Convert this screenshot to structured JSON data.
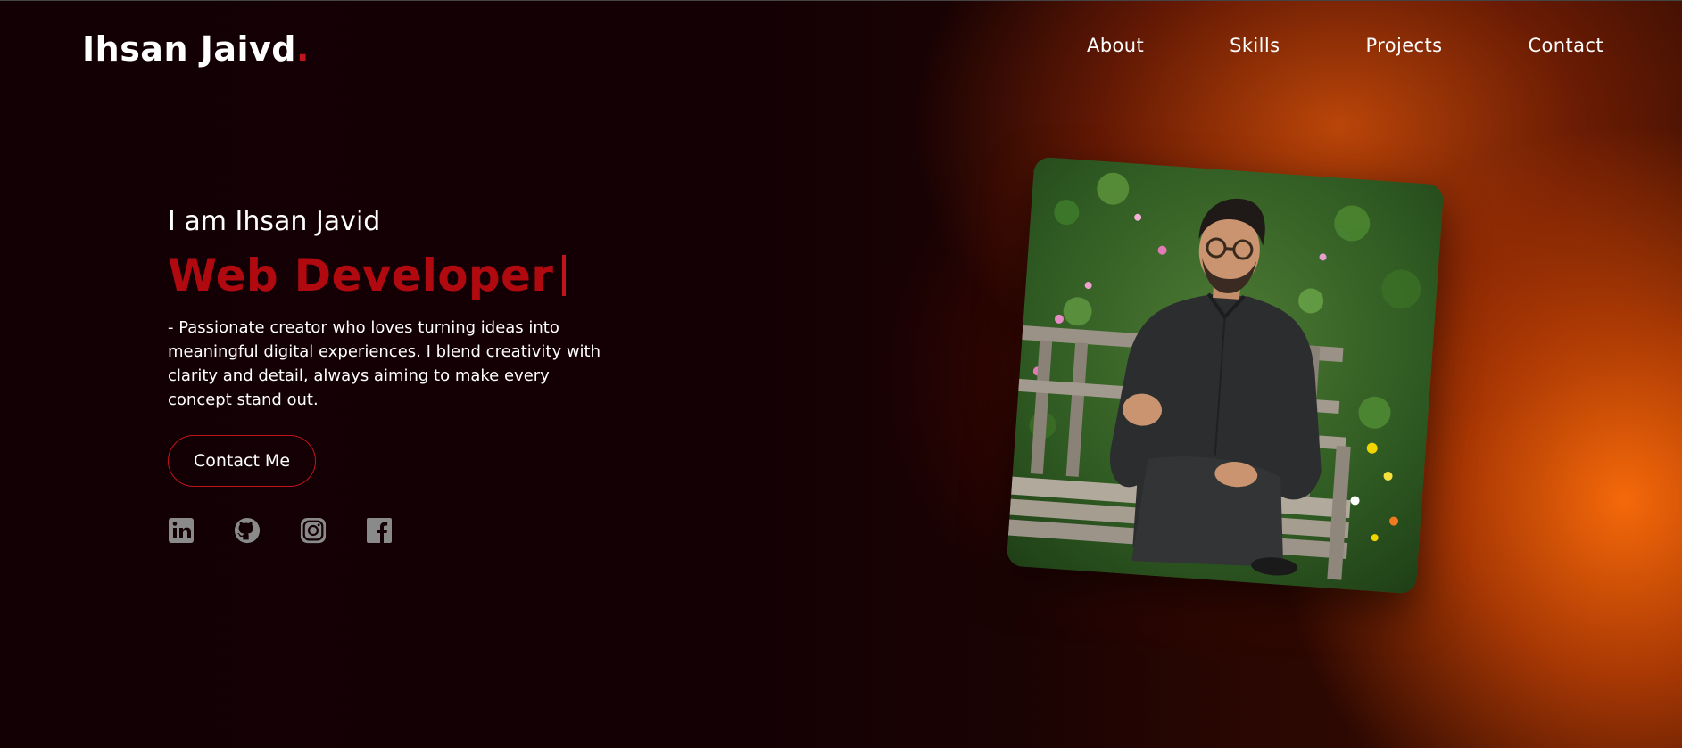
{
  "header": {
    "brand_name": "Ihsan Jaivd",
    "brand_dot": ".",
    "nav": [
      {
        "label": "About"
      },
      {
        "label": "Skills"
      },
      {
        "label": "Projects"
      },
      {
        "label": "Contact"
      }
    ]
  },
  "hero": {
    "intro": "I am Ihsan Javid",
    "role": "Web Developer",
    "description": "- Passionate creator who loves turning ideas into meaningful digital experiences. I blend creativity with clarity and detail, always aiming to make every concept stand out.",
    "cta_label": "Contact Me",
    "socials": [
      {
        "icon": "linkedin-icon"
      },
      {
        "icon": "github-icon"
      },
      {
        "icon": "instagram-icon"
      },
      {
        "icon": "facebook-icon"
      }
    ]
  },
  "colors": {
    "background": "#130005",
    "accent_red": "#b00a10",
    "glow_orange": "#ff6e0a",
    "text": "#ffffff",
    "icon_gray": "#8a8a8a"
  }
}
